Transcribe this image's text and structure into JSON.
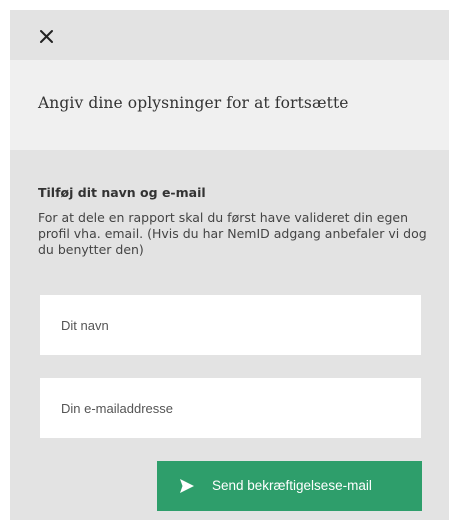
{
  "dialog": {
    "close_icon": "close-icon",
    "title": "Angiv dine oplysninger for at fortsætte"
  },
  "form": {
    "heading": "Tilføj dit navn og e-mail",
    "description": "For at dele en rapport skal du først have valideret din egen profil vha. email. (Hvis du har NemID adgang anbefaler vi dog du benytter den)",
    "name_placeholder": "Dit navn",
    "email_placeholder": "Din e-mailaddresse",
    "send_button": {
      "icon": "send-icon",
      "label": "Send bekræftigelsese-mail"
    }
  },
  "colors": {
    "background": "#e3e3e3",
    "header_background": "#f0f0f0",
    "accent": "#2e9e6b"
  }
}
